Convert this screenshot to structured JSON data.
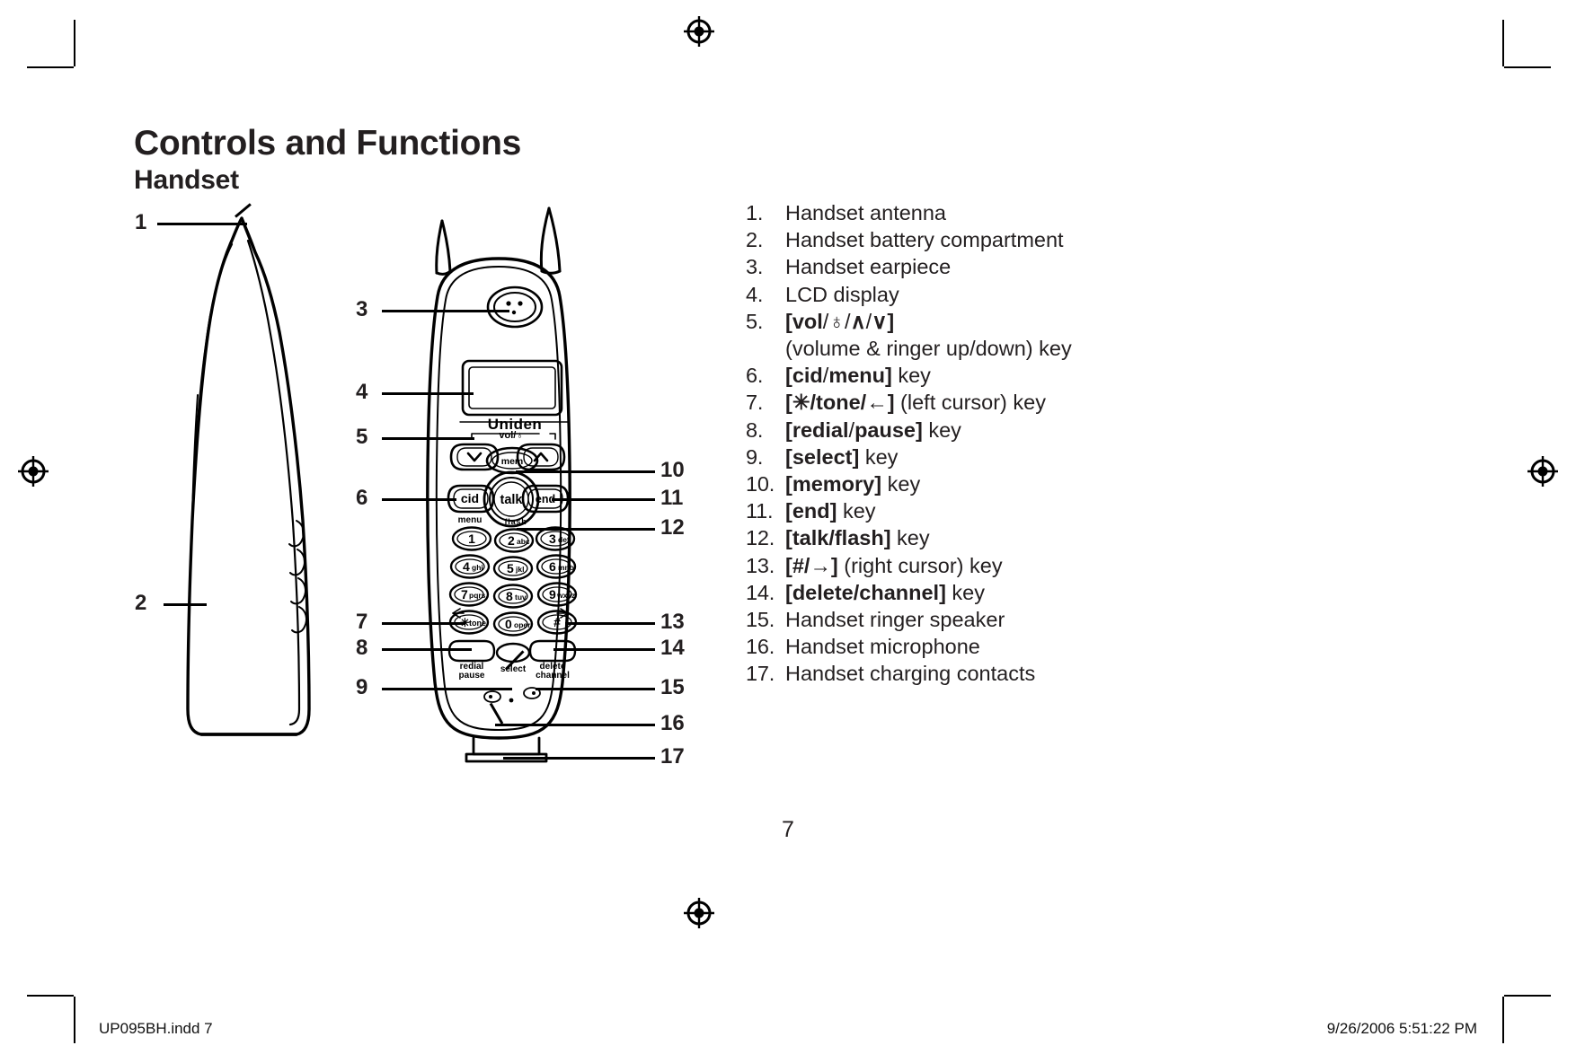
{
  "document": {
    "title": "Controls and Functions",
    "subtitle": "Handset",
    "page_number": "7"
  },
  "footer": {
    "left": "UP095BH.indd   7",
    "right": "9/26/2006   5:51:22 PM"
  },
  "legend": {
    "items": [
      {
        "num": "1.",
        "text": "Handset antenna",
        "html": "Handset antenna"
      },
      {
        "num": "2.",
        "text": "Handset battery compartment",
        "html": "Handset battery compartment"
      },
      {
        "num": "3.",
        "text": "Handset earpiece",
        "html": "Handset earpiece"
      },
      {
        "num": "4.",
        "text": "LCD display",
        "html": "LCD display"
      },
      {
        "num": "5.",
        "text": "[vol/♁/∧/∨]",
        "html": "<b>[vol</b>/<b class=\"glyph\">♁</b>/<b class=\"glyph\">∧</b>/<b class=\"glyph\">∨</b><b>]</b>",
        "sub": "(volume & ringer up/down) key"
      },
      {
        "num": "6.",
        "text": "[cid/menu] key",
        "html": "<b>[cid</b>/<b>menu]</b> key"
      },
      {
        "num": "7.",
        "text": "[✳/tone/←] (left cursor) key",
        "html": "<b>[</b><b class=\"glyph\">✳</b><b>/tone/←]</b> (left cursor) key"
      },
      {
        "num": "8.",
        "text": "[redial/pause] key",
        "html": "<b>[redial</b>/<b>pause]</b> key"
      },
      {
        "num": "9.",
        "text": "[select] key",
        "html": "<b>[select]</b> key"
      },
      {
        "num": "10.",
        "text": "[memory] key",
        "html": "<b>[memory]</b> key"
      },
      {
        "num": "11.",
        "text": "[end] key",
        "html": "<b>[end]</b> key"
      },
      {
        "num": "12.",
        "text": "[talk/flash] key",
        "html": "<b>[talk/flash]</b> key"
      },
      {
        "num": "13.",
        "text": "[#/→] (right cursor) key",
        "html": "<b>[#/→]</b> (right cursor) key"
      },
      {
        "num": "14.",
        "text": "[delete/channel] key",
        "html": "<b>[delete/channel]</b> key"
      },
      {
        "num": "15.",
        "text": "Handset ringer speaker",
        "html": "Handset ringer speaker"
      },
      {
        "num": "16.",
        "text": "Handset microphone",
        "html": "Handset microphone"
      },
      {
        "num": "17.",
        "text": "Handset charging contacts",
        "html": "Handset charging contacts"
      }
    ]
  },
  "callouts": {
    "left": [
      "1",
      "3",
      "4",
      "5",
      "6",
      "2",
      "7",
      "8",
      "9"
    ],
    "right": [
      "10",
      "11",
      "12",
      "13",
      "14",
      "15",
      "16",
      "17"
    ]
  },
  "handset": {
    "brand": "Uniden",
    "vol_label": "vol/♁",
    "soft_keys": {
      "memory": "mem",
      "cid": "cid",
      "talk": "talk",
      "end": "end",
      "menu_sub": "menu",
      "flash_sub": "flash"
    },
    "keypad": [
      {
        "digit": "1",
        "letters": ""
      },
      {
        "digit": "2",
        "letters": "abc"
      },
      {
        "digit": "3",
        "letters": "def"
      },
      {
        "digit": "4",
        "letters": "ghi"
      },
      {
        "digit": "5",
        "letters": "jkl"
      },
      {
        "digit": "6",
        "letters": "mno"
      },
      {
        "digit": "7",
        "letters": "pqrs"
      },
      {
        "digit": "8",
        "letters": "tuv"
      },
      {
        "digit": "9",
        "letters": "wxyz"
      },
      {
        "digit": "✳",
        "letters": "tone"
      },
      {
        "digit": "0",
        "letters": "oper"
      },
      {
        "digit": "#",
        "letters": ""
      }
    ],
    "bottom_keys": {
      "redial": "redial",
      "pause": "pause",
      "select": "select",
      "delete": "delete",
      "channel": "channel"
    },
    "cursor_left": "←",
    "cursor_right": "→"
  },
  "colors": {
    "ink": "#231f20",
    "page": "#ffffff"
  }
}
